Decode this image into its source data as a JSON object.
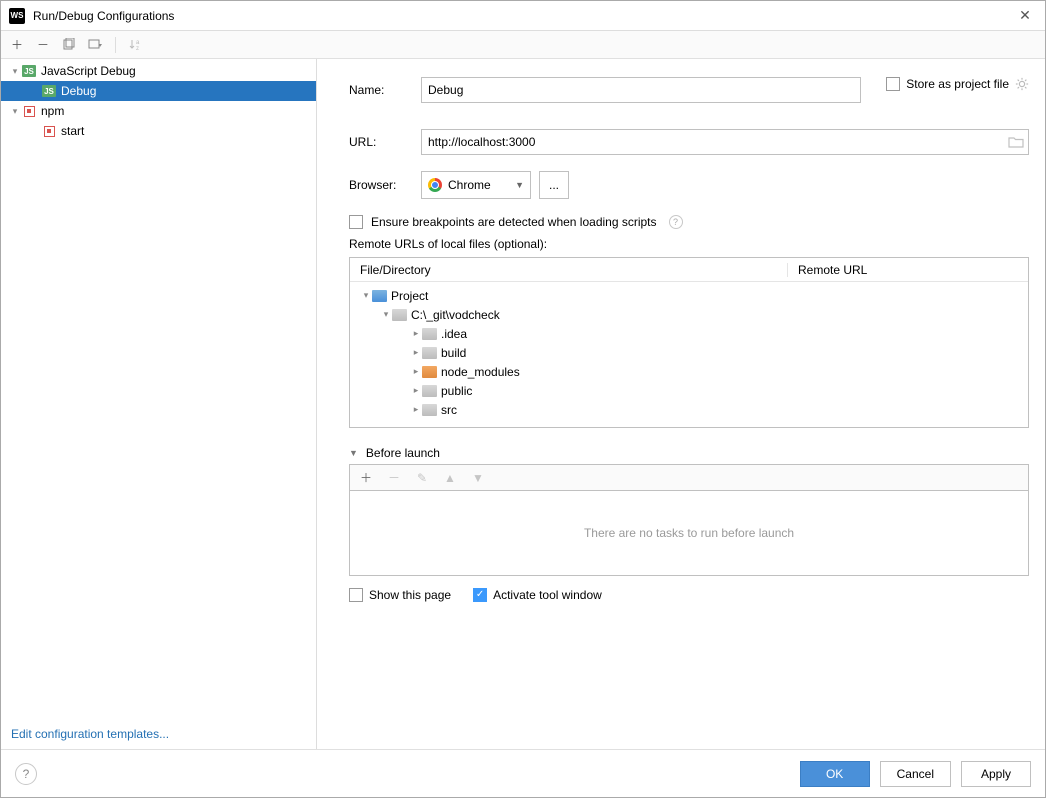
{
  "window": {
    "title": "Run/Debug Configurations"
  },
  "tree": {
    "jsdebug_label": "JavaScript Debug",
    "debug_label": "Debug",
    "npm_label": "npm",
    "start_label": "start"
  },
  "leftFooter": {
    "editTemplates": "Edit configuration templates..."
  },
  "form": {
    "name_label": "Name:",
    "name_value": "Debug",
    "store_label": "Store as project file",
    "url_label": "URL:",
    "url_value": "http://localhost:3000",
    "browser_label": "Browser:",
    "browser_value": "Chrome",
    "ensure_label": "Ensure breakpoints are detected when loading scripts",
    "remote_label": "Remote URLs of local files (optional):",
    "col_file": "File/Directory",
    "col_remote": "Remote URL"
  },
  "filetree": {
    "project": "Project",
    "root": "C:\\_git\\vodcheck",
    "idea": ".idea",
    "build": "build",
    "node_modules": "node_modules",
    "public": "public",
    "src": "src"
  },
  "beforeLaunch": {
    "title": "Before launch",
    "empty": "There are no tasks to run before launch"
  },
  "options": {
    "show_page": "Show this page",
    "activate_tool": "Activate tool window"
  },
  "buttons": {
    "ok": "OK",
    "cancel": "Cancel",
    "apply": "Apply"
  }
}
